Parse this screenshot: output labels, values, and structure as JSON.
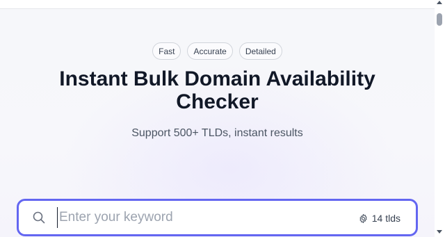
{
  "hero": {
    "tags": [
      {
        "label": "Fast"
      },
      {
        "label": "Accurate"
      },
      {
        "label": "Detailed"
      }
    ],
    "title_line1": "Instant Bulk Domain Availability",
    "title_line2": "Checker",
    "subtitle": "Support 500+ TLDs, instant results"
  },
  "search": {
    "value": "",
    "placeholder": "Enter your keyword",
    "search_icon": "search-icon",
    "tld_icon": "gear-icon",
    "tld_label": "14 tlds"
  },
  "colors": {
    "accent": "#6366f1",
    "text": "#111827",
    "muted": "#4b5563",
    "tag_border": "#d1d5db"
  }
}
